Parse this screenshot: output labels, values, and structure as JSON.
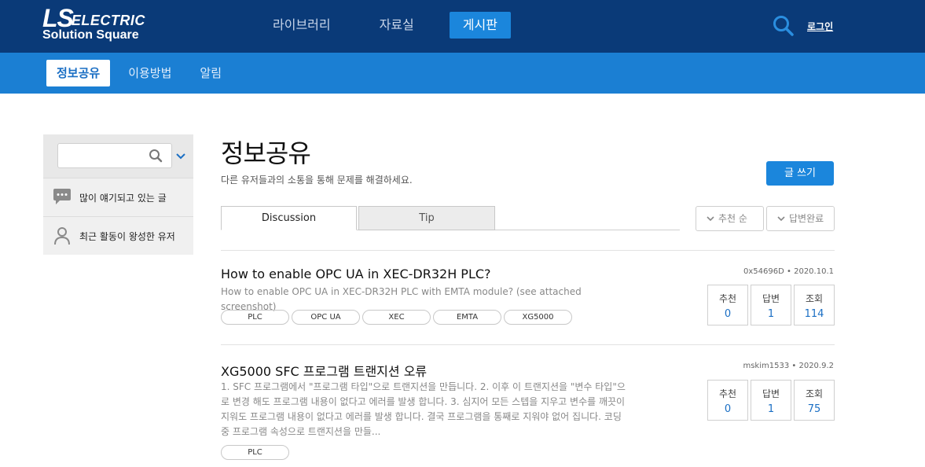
{
  "header": {
    "logo_main": "LS",
    "logo_electric": "ELECTRIC",
    "logo_sub": "Solution Square",
    "nav": [
      "라이브러리",
      "자료실",
      "게시판"
    ],
    "active_nav": "게시판",
    "login": "로그인",
    "search_icon": "search-icon"
  },
  "subnav": {
    "items": [
      "정보공유",
      "이용방법",
      "알림"
    ],
    "active": "정보공유"
  },
  "sidebar": {
    "search_placeholder": "",
    "items": [
      {
        "icon": "speech-bubble-icon",
        "label": "많이 얘기되고 있는 글"
      },
      {
        "icon": "user-icon",
        "label": "최근 활동이 왕성한 유저"
      }
    ]
  },
  "main": {
    "title": "정보공유",
    "description": "다른 유저들과의 소통을 통해 문제를 해결하세요.",
    "write_button": "글 쓰기",
    "tabs": [
      "Discussion",
      "Tip"
    ],
    "active_tab": "Discussion",
    "sort_buttons": [
      "추천 순",
      "답변완료"
    ]
  },
  "posts": [
    {
      "title": "How to enable OPC UA in XEC-DR32H PLC?",
      "excerpt": "How to enable OPC UA in XEC-DR32H PLC with EMTA module? (see attached screenshot)",
      "author": "0x54696D",
      "date": "2020.10.1",
      "tags": [
        "PLC",
        "OPC UA",
        "XEC",
        "EMTA",
        "XG5000"
      ],
      "stats": [
        {
          "label": "추천",
          "value": "0"
        },
        {
          "label": "답변",
          "value": "1"
        },
        {
          "label": "조회",
          "value": "114"
        }
      ]
    },
    {
      "title": "XG5000 SFC 프로그램 트랜지션 오류",
      "excerpt": "1. SFC 프로그램에서 \"프로그램 타입\"으로 트랜지션을 만듭니다. 2. 이후 이 트랜지션을 \"변수 타입\"으로 변경 해도 프로그램 내용이 없다고 에러를 발생 합니다. 3. 심지어 모든 스텝을 지우고 변수를 깨끗이 지워도 프로그램 내용이 없다고 에러를 발생 합니다. 결국 프로그램을 통째로 지워야 없어 집니다. 코딩 중 프로그램 속성으로 트랜지션을 만들...",
      "author": "mskim1533",
      "date": "2020.9.2",
      "tags": [
        "PLC"
      ],
      "stats": [
        {
          "label": "추천",
          "value": "0"
        },
        {
          "label": "답변",
          "value": "1"
        },
        {
          "label": "조회",
          "value": "75"
        }
      ]
    }
  ],
  "colors": {
    "header_bg": "#0a3a78",
    "subbar_bg": "#1b7fd3",
    "accent": "#1b86dc",
    "link_value": "#1b6fc4"
  }
}
